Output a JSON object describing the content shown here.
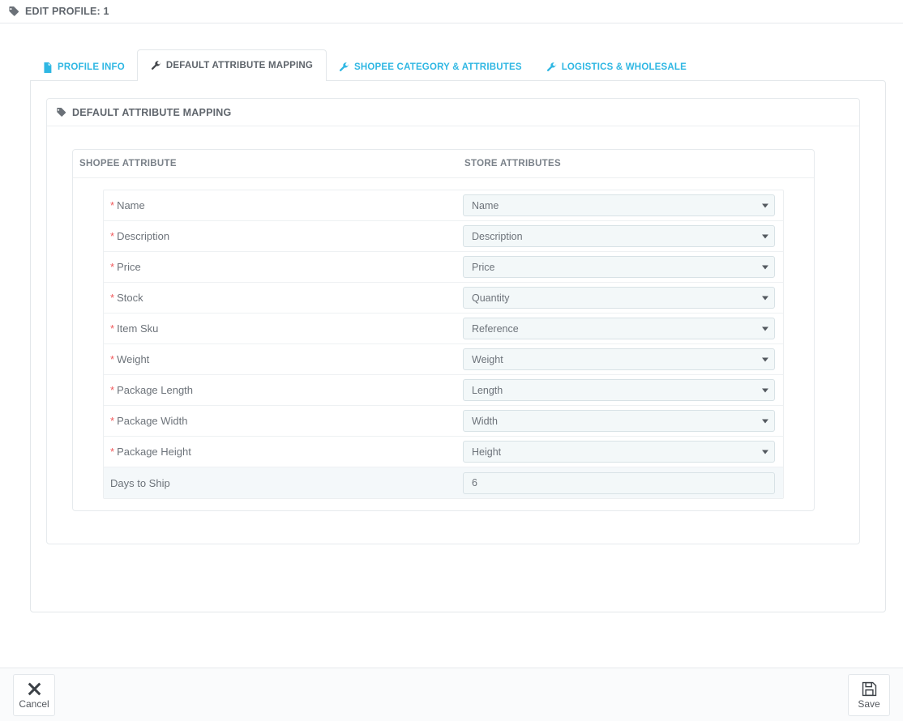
{
  "header": {
    "icon": "tag-icon",
    "title": "EDIT PROFILE: 1"
  },
  "tabs": [
    {
      "label": "PROFILE INFO",
      "icon": "file-text-icon",
      "active": false
    },
    {
      "label": "DEFAULT ATTRIBUTE MAPPING",
      "icon": "wrench-icon",
      "active": true
    },
    {
      "label": "SHOPEE CATEGORY & ATTRIBUTES",
      "icon": "wrench-icon",
      "active": false
    },
    {
      "label": "LOGISTICS & WHOLESALE",
      "icon": "wrench-icon",
      "active": false
    }
  ],
  "panel": {
    "icon": "tag-icon",
    "title": "DEFAULT ATTRIBUTE MAPPING"
  },
  "table": {
    "columns": {
      "left": "SHOPEE ATTRIBUTE",
      "right": "STORE ATTRIBUTES"
    },
    "rows": [
      {
        "label": "Name",
        "required": true,
        "control": "select",
        "value": "Name"
      },
      {
        "label": "Description",
        "required": true,
        "control": "select",
        "value": "Description"
      },
      {
        "label": "Price",
        "required": true,
        "control": "select",
        "value": "Price"
      },
      {
        "label": "Stock",
        "required": true,
        "control": "select",
        "value": "Quantity"
      },
      {
        "label": "Item Sku",
        "required": true,
        "control": "select",
        "value": "Reference"
      },
      {
        "label": "Weight",
        "required": true,
        "control": "select",
        "value": "Weight"
      },
      {
        "label": "Package Length",
        "required": true,
        "control": "select",
        "value": "Length"
      },
      {
        "label": "Package Width",
        "required": true,
        "control": "select",
        "value": "Width"
      },
      {
        "label": "Package Height",
        "required": true,
        "control": "select",
        "value": "Height"
      },
      {
        "label": "Days to Ship",
        "required": false,
        "control": "text",
        "value": "6"
      }
    ],
    "required_marker": "*"
  },
  "footer": {
    "cancel": {
      "label": "Cancel",
      "icon": "close-x-icon"
    },
    "save": {
      "label": "Save",
      "icon": "floppy-disk-icon"
    }
  },
  "colors": {
    "tab_link": "#2fb7e3",
    "required": "#f0595b",
    "text": "#6d737a",
    "field_bg": "#f3f8f9",
    "field_border": "#d8e2e6"
  }
}
